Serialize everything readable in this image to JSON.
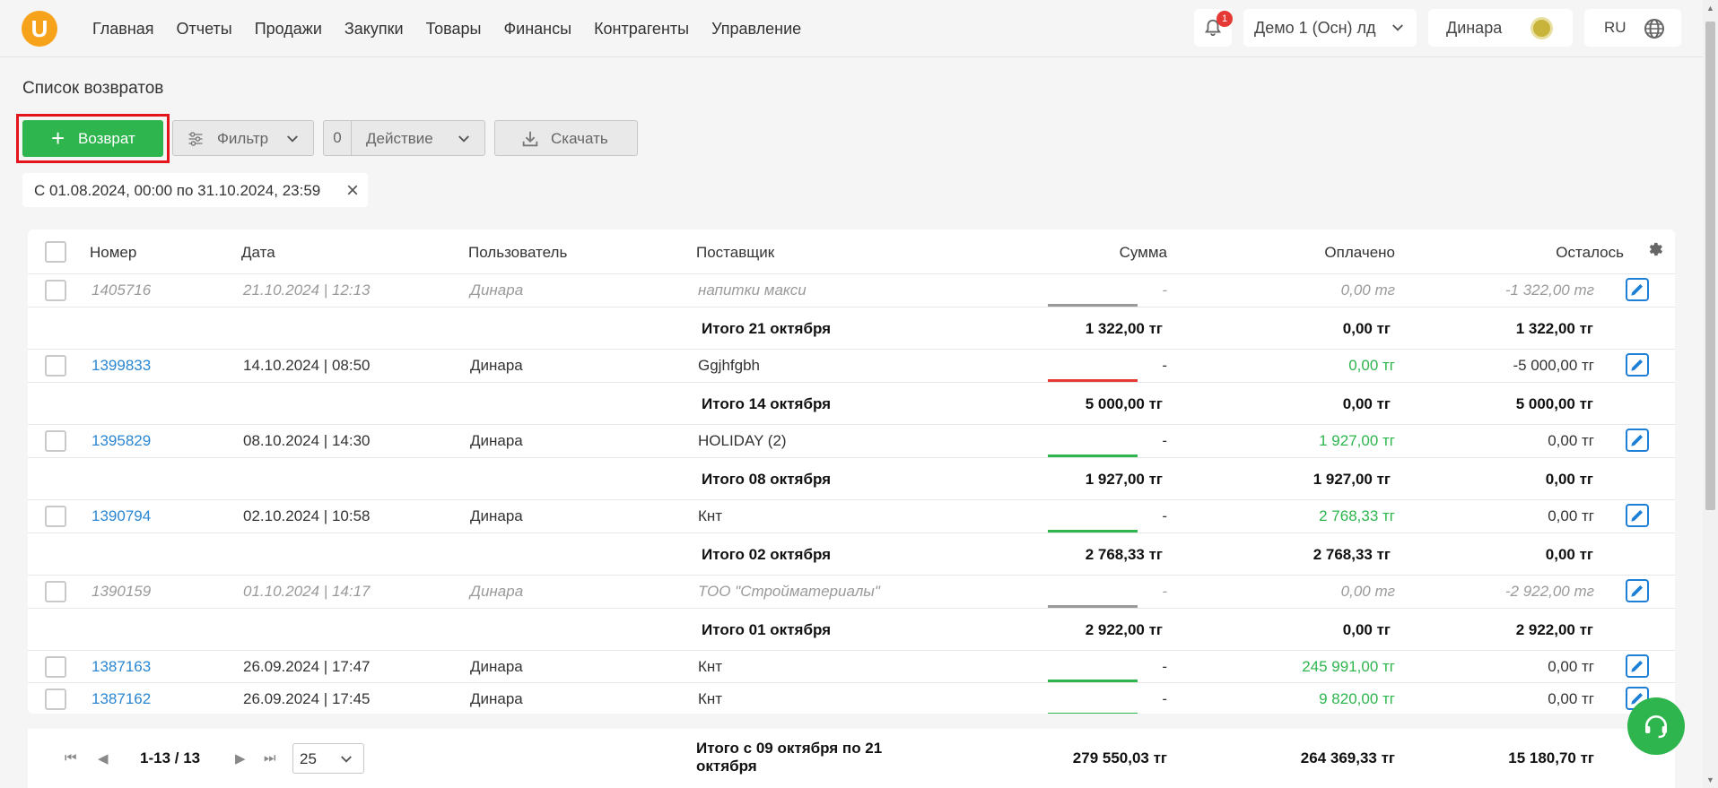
{
  "nav": [
    "Главная",
    "Отчеты",
    "Продажи",
    "Закупки",
    "Товары",
    "Финансы",
    "Контрагенты",
    "Управление"
  ],
  "header": {
    "logo": "U",
    "notification_count": "1",
    "company": "Демо 1 (Осн) лд",
    "user": "Динара",
    "lang": "RU"
  },
  "page": {
    "title": "Список возвратов"
  },
  "toolbar": {
    "add_label": "Возврат",
    "filter_label": "Фильтр",
    "action_count": "0",
    "action_label": "Действие",
    "download_label": "Скачать"
  },
  "chip": {
    "label": "С 01.08.2024, 00:00 по 31.10.2024, 23:59"
  },
  "table": {
    "columns": [
      "Номер",
      "Дата",
      "Пользователь",
      "Поставщик",
      "Сумма",
      "Оплачено",
      "Осталось"
    ],
    "rows": [
      {
        "number": "1405716",
        "date": "21.10.2024 | 12:13",
        "user": "Динара",
        "supplier": "напитки макси",
        "sum": "-",
        "paid": "0,00 тг",
        "left": "-1 322,00 тг",
        "state": "muted"
      },
      {
        "total_label": "Итого 21 октября",
        "sum": "1 322,00 тг",
        "paid": "0,00 тг",
        "left": "1 322,00 тг"
      },
      {
        "number": "1399833",
        "date": "14.10.2024 | 08:50",
        "user": "Динара",
        "supplier": "Ggjhfgbh",
        "sum": "-",
        "paid": "0,00 тг",
        "left": "-5 000,00 тг",
        "state": "normal"
      },
      {
        "total_label": "Итого 14 октября",
        "sum": "5 000,00 тг",
        "paid": "0,00 тг",
        "left": "5 000,00 тг"
      },
      {
        "number": "1395829",
        "date": "08.10.2024 | 14:30",
        "user": "Динара",
        "supplier": "HOLIDAY (2)",
        "sum": "-",
        "paid": "1 927,00 тг",
        "left": "0,00 тг",
        "state": "normal"
      },
      {
        "total_label": "Итого 08 октября",
        "sum": "1 927,00 тг",
        "paid": "1 927,00 тг",
        "left": "0,00 тг"
      },
      {
        "number": "1390794",
        "date": "02.10.2024 | 10:58",
        "user": "Динара",
        "supplier": "Кнт",
        "sum": "-",
        "paid": "2 768,33 тг",
        "left": "0,00 тг",
        "state": "normal"
      },
      {
        "total_label": "Итого 02 октября",
        "sum": "2 768,33 тг",
        "paid": "2 768,33 тг",
        "left": "0,00 тг"
      },
      {
        "number": "1390159",
        "date": "01.10.2024 | 14:17",
        "user": "Динара",
        "supplier": "ТОО \"Стройматериалы\"",
        "sum": "-",
        "paid": "0,00 тг",
        "left": "-2 922,00 тг",
        "state": "muted"
      },
      {
        "total_label": "Итого 01 октября",
        "sum": "2 922,00 тг",
        "paid": "0,00 тг",
        "left": "2 922,00 тг"
      },
      {
        "number": "1387163",
        "date": "26.09.2024 | 17:47",
        "user": "Динара",
        "supplier": "Кнт",
        "sum": "-",
        "paid": "245 991,00 тг",
        "left": "0,00 тг",
        "state": "normal"
      },
      {
        "number": "1387162",
        "date": "26.09.2024 | 17:45",
        "user": "Динара",
        "supplier": "Кнт",
        "sum": "-",
        "paid": "9 820,00 тг",
        "left": "0,00 тг",
        "state": "normal"
      }
    ]
  },
  "footer": {
    "range": "1-13 / 13",
    "per_page": "25",
    "total_label": "Итого с 09 октября по 21 октября",
    "sum": "279 550,03 тг",
    "paid": "264 369,33 тг",
    "left": "15 180,70 тг"
  },
  "colors": {
    "accent": "#2eb54e",
    "link": "#2a86d1",
    "danger": "#e53935",
    "muted": "#9a9a9a"
  }
}
